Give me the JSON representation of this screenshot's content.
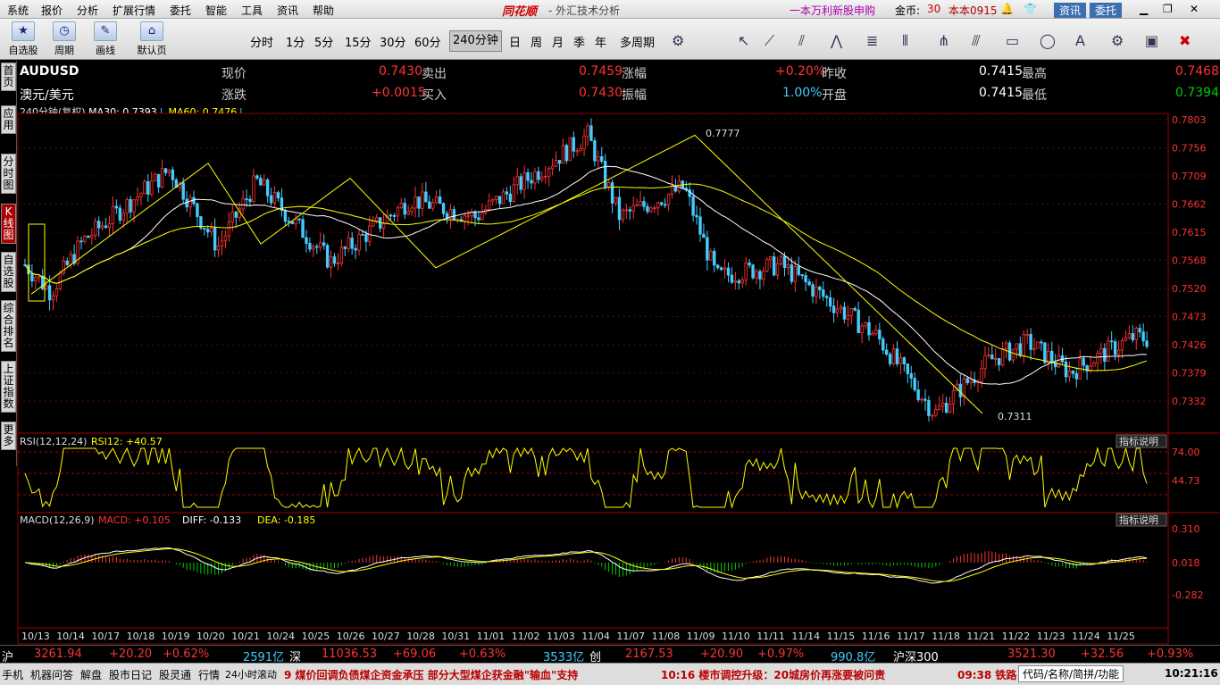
{
  "menu": {
    "items": [
      "系统",
      "报价",
      "分析",
      "扩展行情",
      "委托",
      "智能",
      "工具",
      "资讯",
      "帮助"
    ],
    "brand": "同花顺",
    "subtitle": "- 外汇技术分析",
    "promo": "一本万利新股申购",
    "gold_label": "金币:",
    "gold_value": "30",
    "ticket": "本本0915",
    "news_btn": "资讯",
    "trade_btn": "委托"
  },
  "toolbar": {
    "buttons": [
      "自选股",
      "周期",
      "画线",
      "默认页"
    ],
    "periods": [
      "分时",
      "1分",
      "5分",
      "15分",
      "30分",
      "60分",
      "240分钟",
      "日",
      "周",
      "月",
      "季",
      "年",
      "多周期"
    ],
    "active_period": "240分钟"
  },
  "sidebar": {
    "tabs": [
      "首页",
      "应用",
      "分时图",
      "K线图",
      "自选股",
      "综合排名",
      "上证指数",
      "更多"
    ],
    "active": "K线图"
  },
  "quote": {
    "code": "AUDUSD",
    "name": "澳元/美元",
    "now_label": "现价",
    "now": "0.7430",
    "sell_label": "卖出",
    "sell": "0.7459",
    "amp_label": "涨幅",
    "amp": "+0.20%",
    "prev_label": "昨收",
    "prev": "0.7415",
    "high_label": "最高",
    "high": "0.7468",
    "chg_label": "涨跌",
    "chg": "+0.0015",
    "buy_label": "买入",
    "buy": "0.7430",
    "swing_label": "振幅",
    "swing": "1.00%",
    "open_label": "开盘",
    "open": "0.7415",
    "low_label": "最低",
    "low": "0.7394"
  },
  "chart_info": {
    "period": "240分钟(复权)",
    "ma30": "MA30: 0.7393",
    "ma60": "MA60: 0.7476",
    "rsi": "RSI(12,12,24)",
    "rsi12": "RSI12: +40.57",
    "macd": "MACD(12,26,9)",
    "macd_v": "MACD: +0.105",
    "diff": "DIFF: -0.133",
    "dea": "DEA: -0.185",
    "help1": "指标说明",
    "help2": "指标说明",
    "hi_label": "0.7777",
    "lo_label": "0.7311"
  },
  "chart_data": {
    "type": "candlestick",
    "y_ticks": [
      "0.7803",
      "0.7756",
      "0.7709",
      "0.7662",
      "0.7615",
      "0.7568",
      "0.7520",
      "0.7473",
      "0.7426",
      "0.7379",
      "0.7332"
    ],
    "ylim": [
      0.7311,
      0.7803
    ],
    "rsi_ticks": [
      "74.00",
      "44.73"
    ],
    "macd_ticks": [
      "0.310",
      "0.018",
      "-0.282"
    ],
    "x_labels": [
      "10/13",
      "10/14",
      "10/17",
      "10/18",
      "10/19",
      "10/20",
      "10/21",
      "10/24",
      "10/25",
      "10/26",
      "10/27",
      "10/28",
      "10/31",
      "11/01",
      "11/02",
      "11/03",
      "11/04",
      "11/07",
      "11/08",
      "11/09",
      "11/10",
      "11/11",
      "11/14",
      "11/15",
      "11/16",
      "11/17",
      "11/18",
      "11/21",
      "11/22",
      "11/23",
      "11/24",
      "11/25"
    ],
    "high": 0.7777,
    "low": 0.7311
  },
  "bottom": {
    "sh_label": "沪",
    "sh": "3261.94",
    "sh_chg": "+20.20",
    "sh_pct": "+0.62%",
    "sh_amt": "2591亿",
    "sz_label": "深",
    "sz": "11036.53",
    "sz_chg": "+69.06",
    "sz_pct": "+0.63%",
    "sz_amt": "3533亿",
    "cy_label": "创",
    "cy": "2167.53",
    "cy_chg": "+20.90",
    "cy_pct": "+0.97%",
    "cy_amt": "990.8亿",
    "hs_label": "沪深300",
    "hs": "3521.30",
    "hs_chg": "+32.56",
    "hs_pct": "+0.93%"
  },
  "status": {
    "items": [
      "手机",
      "机器问答",
      "解盘",
      "股市日记",
      "股灵通",
      "行情",
      "24小时滚动"
    ],
    "news1": "9 煤价回调负债煤企资金承压 部分大型煤企获金融\"输血\"支持",
    "news2": "10:16 楼市调控升级：20城房价再涨要被问责",
    "news3": "09:38 铁路",
    "search": "代码/名称/简拼/功能",
    "time": "10:21:16"
  }
}
